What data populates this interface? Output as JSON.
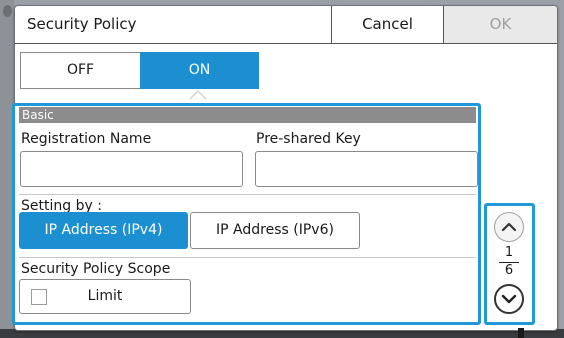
{
  "dialog": {
    "title": "Security Policy",
    "cancel_label": "Cancel",
    "ok_label": "OK"
  },
  "toggle": {
    "off_label": "OFF",
    "on_label": "ON",
    "selected": "ON"
  },
  "basic_section": {
    "header": "Basic",
    "registration_name_label": "Registration Name",
    "registration_name_value": "",
    "preshared_key_label": "Pre-shared Key",
    "preshared_key_value": ""
  },
  "setting_by": {
    "label": "Setting by :",
    "options": [
      "IP Address (IPv4)",
      "IP Address (IPv6)"
    ],
    "selected": "IP Address (IPv4)"
  },
  "scope": {
    "label": "Security Policy Scope",
    "limit_label": "Limit",
    "limit_checked": false
  },
  "pager": {
    "current": "1",
    "total": "6"
  },
  "colors": {
    "accent": "#1c8fd1",
    "frame_highlight": "#1f97d8",
    "disabled_text": "#a0a0a0"
  }
}
